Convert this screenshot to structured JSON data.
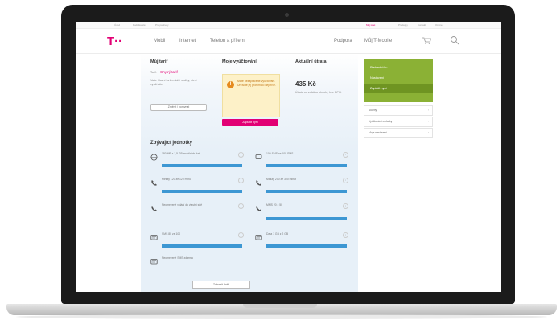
{
  "topbar": {
    "links": [
      "Úvod",
      "Podnikatelé",
      "Pro partnery"
    ],
    "right_links": [
      "Můj účet",
      "Prodejny",
      "Kontakt",
      "Online"
    ]
  },
  "nav": {
    "logo": "T··",
    "items": [
      "Mobil",
      "Internet",
      "Telefon a příjem"
    ],
    "right_items": [
      "Podpora",
      "Můj T-Mobile"
    ]
  },
  "tariff": {
    "title": "Můj tarif",
    "label": "Tarif:",
    "name": "Chytrý tarif",
    "description": "Vaše hlavní tarif a další služby, které využíváte.",
    "button": "Změnit / porovnat"
  },
  "invoices": {
    "title": "Moje vyúčtování",
    "warning": "Máte nezaplacené vyúčtování. Uhraďte jej prosím co nejdříve.",
    "pay_button": "Zaplatit nyní"
  },
  "status": {
    "title": "Aktuální útrata",
    "amount": "435 Kč",
    "description": "Útrata od začátku období, bez DPH."
  },
  "sidebar": {
    "green_items": [
      "Přehled účtu",
      "Nastavení",
      "Zaplatit nyní"
    ],
    "items": [
      "Služby",
      "Vyúčtování a platby",
      "Moje nastavení"
    ]
  },
  "units": {
    "title": "Zbývající jednotky",
    "items": [
      {
        "text": "180 MB z 1,5 GB mobilních dat"
      },
      {
        "text": "100 SMS ze 100 SMS"
      },
      {
        "text": "Minuty 120 ze 120 minut"
      },
      {
        "text": "Minuty 200 ze 300 minut"
      },
      {
        "text": "Neomezené volání do vlastní sítě"
      },
      {
        "text": "MMS 20 z 50"
      },
      {
        "text": "SMS 80 ze 100"
      },
      {
        "text": "Data 1 GB z 2 GB"
      },
      {
        "text": "Neomezené SMS zdarma"
      }
    ],
    "more_button": "Zobrazit další"
  }
}
